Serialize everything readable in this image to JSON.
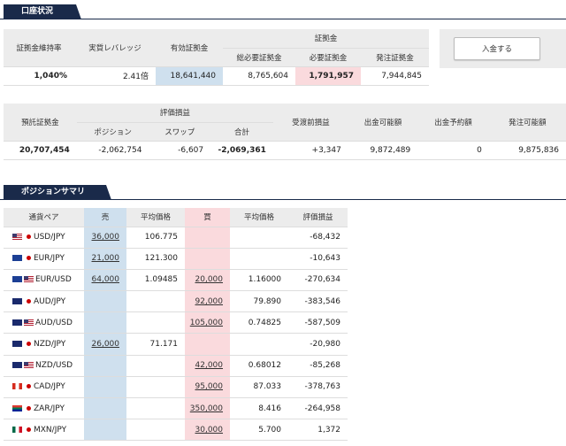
{
  "account": {
    "section_title": "口座状況",
    "row1_headers": {
      "margin_ratio": "証拠金維持率",
      "leverage": "実質レバレッジ",
      "effective_margin": "有効証拠金",
      "margin_group": "証拠金",
      "total_required": "総必要証拠金",
      "required": "必要証拠金",
      "order_margin": "発注証拠金"
    },
    "row1_values": {
      "margin_ratio": "1,040%",
      "leverage": "2.41倍",
      "effective_margin": "18,641,440",
      "total_required": "8,765,604",
      "required": "1,791,957",
      "order_margin": "7,944,845"
    },
    "deposit_button": "入金する",
    "row2_headers": {
      "deposit": "預託証拠金",
      "pl_group": "評価損益",
      "position": "ポジション",
      "swap": "スワップ",
      "total": "合計",
      "pre_settle": "受渡前損益",
      "withdrawable": "出金可能額",
      "withdraw_reserved": "出金予約額",
      "orderable": "発注可能額"
    },
    "row2_values": {
      "deposit": "20,707,454",
      "position": "-2,062,754",
      "swap": "-6,607",
      "total": "-2,069,361",
      "pre_settle": "+3,347",
      "withdrawable": "9,872,489",
      "withdraw_reserved": "0",
      "orderable": "9,875,836"
    }
  },
  "positions": {
    "section_title": "ポジションサマリ",
    "headers": {
      "pair": "通貨ペア",
      "sell": "売",
      "sell_avg": "平均価格",
      "buy": "買",
      "buy_avg": "平均価格",
      "pl": "評価損益"
    },
    "rows": [
      {
        "flag1": "us",
        "flag2": "jp",
        "pair": "USD/JPY",
        "sell": "36,000",
        "sell_avg": "106.775",
        "buy": "",
        "buy_avg": "",
        "pl": "-68,432"
      },
      {
        "flag1": "eu",
        "flag2": "jp",
        "pair": "EUR/JPY",
        "sell": "21,000",
        "sell_avg": "121.300",
        "buy": "",
        "buy_avg": "",
        "pl": "-10,643"
      },
      {
        "flag1": "eu",
        "flag2": "us",
        "pair": "EUR/USD",
        "sell": "64,000",
        "sell_avg": "1.09485",
        "buy": "20,000",
        "buy_avg": "1.16000",
        "pl": "-270,634"
      },
      {
        "flag1": "au",
        "flag2": "jp",
        "pair": "AUD/JPY",
        "sell": "",
        "sell_avg": "",
        "buy": "92,000",
        "buy_avg": "79.890",
        "pl": "-383,546"
      },
      {
        "flag1": "au",
        "flag2": "us",
        "pair": "AUD/USD",
        "sell": "",
        "sell_avg": "",
        "buy": "105,000",
        "buy_avg": "0.74825",
        "pl": "-587,509"
      },
      {
        "flag1": "nz",
        "flag2": "jp",
        "pair": "NZD/JPY",
        "sell": "26,000",
        "sell_avg": "71.171",
        "buy": "",
        "buy_avg": "",
        "pl": "-20,980"
      },
      {
        "flag1": "nz",
        "flag2": "us",
        "pair": "NZD/USD",
        "sell": "",
        "sell_avg": "",
        "buy": "42,000",
        "buy_avg": "0.68012",
        "pl": "-85,268"
      },
      {
        "flag1": "ca",
        "flag2": "jp",
        "pair": "CAD/JPY",
        "sell": "",
        "sell_avg": "",
        "buy": "95,000",
        "buy_avg": "87.033",
        "pl": "-378,763"
      },
      {
        "flag1": "za",
        "flag2": "jp",
        "pair": "ZAR/JPY",
        "sell": "",
        "sell_avg": "",
        "buy": "350,000",
        "buy_avg": "8.416",
        "pl": "-264,958"
      },
      {
        "flag1": "mx",
        "flag2": "jp",
        "pair": "MXN/JPY",
        "sell": "",
        "sell_avg": "",
        "buy": "30,000",
        "buy_avg": "5.700",
        "pl": "1,372"
      }
    ]
  }
}
